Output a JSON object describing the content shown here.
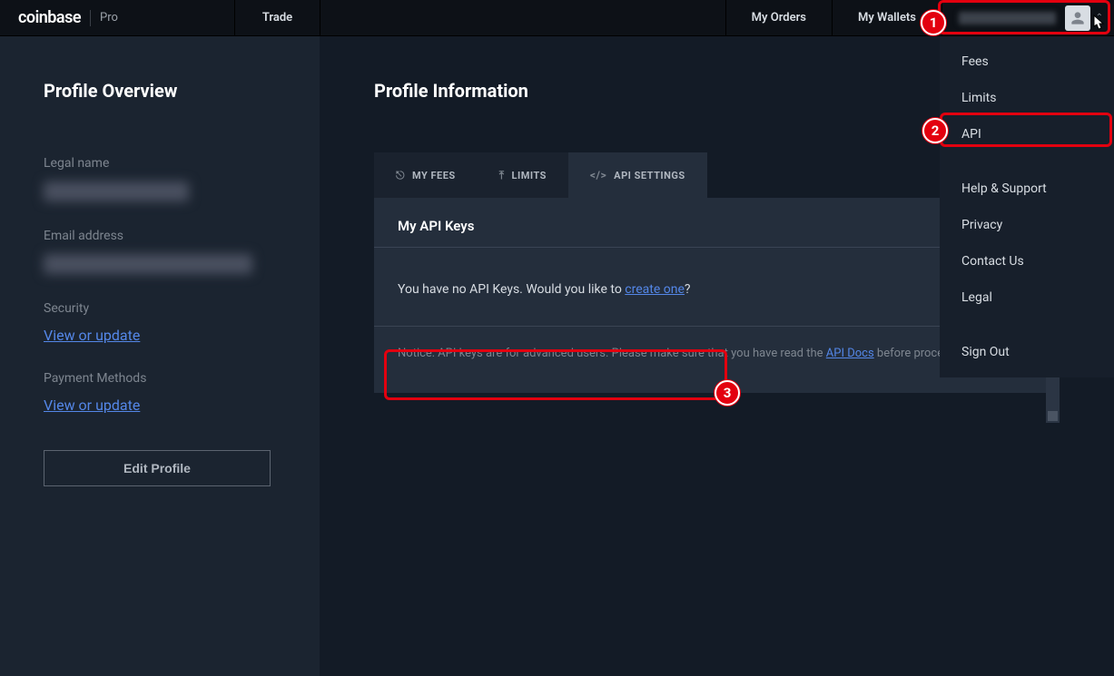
{
  "brand": {
    "main": "coinbase",
    "sub": "Pro"
  },
  "nav": {
    "trade": "Trade",
    "orders": "My Orders",
    "wallets": "My Wallets"
  },
  "dropdown": {
    "fees": "Fees",
    "limits": "Limits",
    "api": "API",
    "help": "Help & Support",
    "privacy": "Privacy",
    "contact": "Contact Us",
    "legal": "Legal",
    "signout": "Sign Out"
  },
  "sidebar": {
    "title": "Profile Overview",
    "legal_name_label": "Legal name",
    "email_label": "Email address",
    "security_label": "Security",
    "security_link": "View or update",
    "payment_label": "Payment Methods",
    "payment_link": "View or update",
    "edit_btn": "Edit Profile"
  },
  "content": {
    "title": "Profile Information",
    "tabs": {
      "fees": "MY FEES",
      "limits": "LIMITS",
      "api": "API SETTINGS"
    },
    "panel_title": "My API Keys",
    "new_key_btn": "+",
    "empty_prefix": "You have no API Keys. Would you like to ",
    "empty_link": "create one",
    "empty_suffix": "?",
    "notice_prefix": "Notice: API keys are for advanced users. Please make sure that you have read the ",
    "notice_link": "API Docs",
    "notice_suffix": " before proceeding."
  },
  "annotations": {
    "b1": "1",
    "b2": "2",
    "b3": "3"
  }
}
